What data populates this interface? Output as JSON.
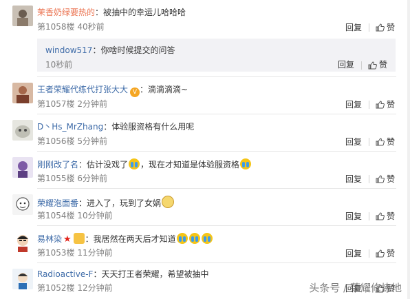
{
  "comments": [
    {
      "username": "茉香奶绿要热的",
      "text": "：被抽中的幸运儿哈哈哈",
      "floor": "第1058楼",
      "time": "40秒前",
      "reply_label": "回复",
      "like_label": "赞",
      "reply": {
        "username": "window517",
        "text": "：你啥时候提交的问答",
        "time": "10秒前",
        "reply_label": "回复",
        "like_label": "赞"
      }
    },
    {
      "username": "王者荣耀代练代打张大大",
      "text": "：滴滴滴滴~",
      "floor": "第1057楼",
      "time": "2分钟前",
      "reply_label": "回复",
      "like_label": "赞"
    },
    {
      "username": "D丶Hs_MrZhang",
      "text": "：体验服资格有什么用呢",
      "floor": "第1056楼",
      "time": "5分钟前",
      "reply_label": "回复",
      "like_label": "赞"
    },
    {
      "username": "刚刚改了名",
      "text": "：估计没戏了",
      "text2": "，现在才知道是体验服资格",
      "floor": "第1055楼",
      "time": "6分钟前",
      "reply_label": "回复",
      "like_label": "赞"
    },
    {
      "username": "荣耀泡面番",
      "text": "：进入了，玩到了女娲",
      "floor": "第1054楼",
      "time": "10分钟前",
      "reply_label": "回复",
      "like_label": "赞"
    },
    {
      "username": "易林染",
      "text": "：我居然在两天后才知道",
      "floor": "第1053楼",
      "time": "11分钟前",
      "reply_label": "回复",
      "like_label": "赞"
    },
    {
      "username": "Radioactive-F",
      "text": "：天天打王者荣耀，希望被抽中",
      "floor": "第1052楼",
      "time": "12分钟前",
      "reply_label": "回复",
      "like_label": "赞"
    }
  ],
  "watermark": "头条号 / 荣耀修炼地",
  "colors": {
    "username": "#eb7350",
    "link_blue": "#3e6ba8",
    "meta": "#808080",
    "reply_bg": "#f2f2f5"
  }
}
